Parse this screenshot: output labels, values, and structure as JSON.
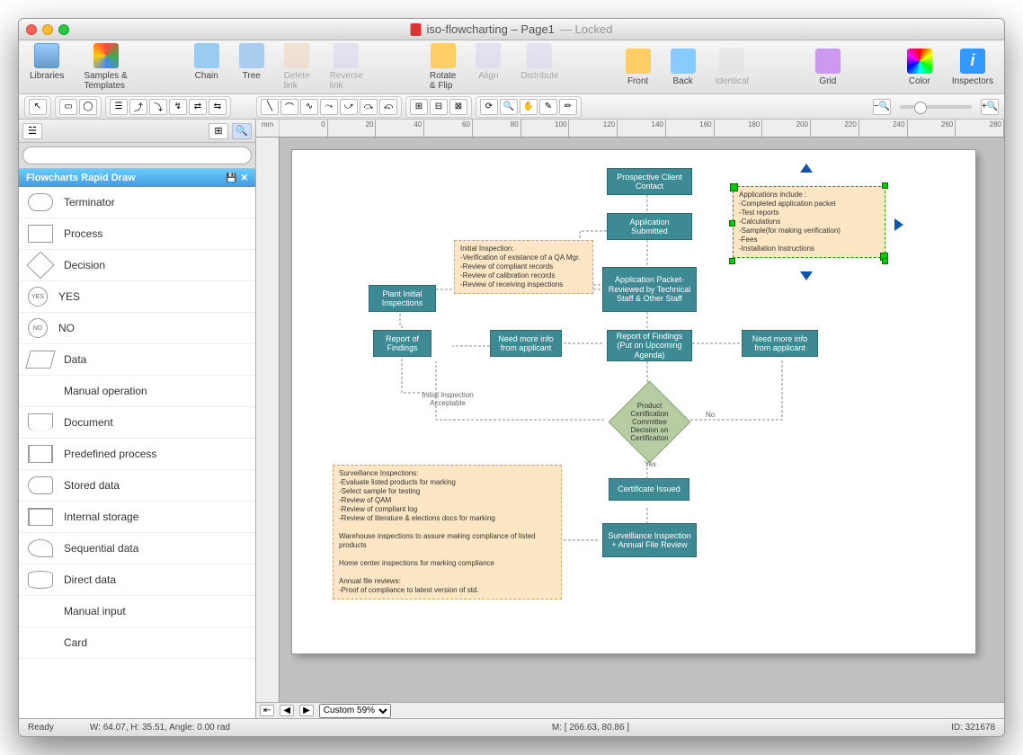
{
  "window": {
    "doc_title": "iso-flowcharting – Page1",
    "lock_status": "— Locked"
  },
  "toolbar": {
    "libraries": "Libraries",
    "samples": "Samples & Templates",
    "chain": "Chain",
    "tree": "Tree",
    "delete_link": "Delete link",
    "reverse_link": "Reverse link",
    "rotate": "Rotate & Flip",
    "align": "Align",
    "distribute": "Distribute",
    "front": "Front",
    "back": "Back",
    "identical": "Identical",
    "grid": "Grid",
    "color": "Color",
    "inspectors": "Inspectors"
  },
  "sidebar": {
    "header": "Flowcharts Rapid Draw",
    "search_placeholder": "",
    "items": [
      {
        "label": "Terminator"
      },
      {
        "label": "Process"
      },
      {
        "label": "Decision"
      },
      {
        "label": "YES"
      },
      {
        "label": "NO"
      },
      {
        "label": "Data"
      },
      {
        "label": "Manual operation"
      },
      {
        "label": "Document"
      },
      {
        "label": "Predefined process"
      },
      {
        "label": "Stored data"
      },
      {
        "label": "Internal storage"
      },
      {
        "label": "Sequential data"
      },
      {
        "label": "Direct data"
      },
      {
        "label": "Manual input"
      },
      {
        "label": "Card"
      }
    ]
  },
  "ruler": {
    "unit": "mm",
    "ticks": [
      0,
      20,
      40,
      60,
      80,
      100,
      120,
      140,
      160,
      180,
      200,
      220,
      240,
      260,
      280
    ]
  },
  "flow": {
    "b1": "Prospective Client Contact",
    "b2": "Application Submitted",
    "b3": "Application Packet- Reviewed by Technical Staff & Other Staff",
    "b4": "Report of Findings (Put on Upcoming Agenda)",
    "b5": "Need more info from applicant",
    "b6": "Need more info from applicant",
    "b7": "Plant Initial Inspections",
    "b8": "Report of Findings",
    "d1": "Product Certification Committee Decision on Certification",
    "b9": "Certificate Issued",
    "b10": "Surveillance Inspection + Annual File Review",
    "note1": "Initial Inspection:\n-Verification of existance of a QA Mgr.\n-Review of compliant records\n-Review of calibration records\n-Review of receiving inspections",
    "note2": "Applications include :\n-Completed application packet\n-Test reports\n-Calculations\n-Sample(for making verification)\n-Fees\n-Installation Instructions",
    "note3": "Surveillance Inspections:\n-Evaluate listed products for marking\n-Select sample for testing\n-Review of QAM\n-Review of compliant log\n-Review of literature & elections docs for marking\n\nWarehouse inspections to assure making compliance of listed products\n\nHome center inspections for marking compliance\n\nAnnual file reviews:\n-Proof of compliance to latest version of std.",
    "lbl_init": "Initial Inspection Acceptable",
    "lbl_yes": "Yes",
    "lbl_no": "No"
  },
  "bottom": {
    "zoom_label": "Custom 59%"
  },
  "status": {
    "ready": "Ready",
    "dims": "W: 64.07,  H: 35.51,  Angle: 0.00 rad",
    "mouse": "M: [ 266.63, 80.86 ]",
    "id": "ID: 321678"
  }
}
